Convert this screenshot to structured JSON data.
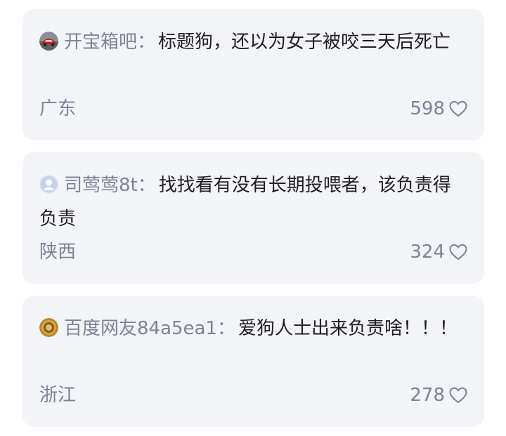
{
  "comments": [
    {
      "avatar_icon": "car-avatar-icon",
      "username": "开宝箱吧",
      "separator": "：",
      "text": "标题狗，还以为女子被咬三天后死亡",
      "location": "广东",
      "likes": "598"
    },
    {
      "avatar_icon": "default-user-avatar-icon",
      "username": "司莺莺8t",
      "separator": "：",
      "text": "找找看有没有长期投喂者，该负责得负责",
      "location": "陕西",
      "likes": "324"
    },
    {
      "avatar_icon": "coin-avatar-icon",
      "username": "百度网友84a5ea1",
      "separator": "：",
      "text": "爱狗人士出来负责啥！！！",
      "location": "浙江",
      "likes": "278"
    }
  ],
  "colors": {
    "card_bg": "#f3f4f8",
    "secondary_text": "#7b8494",
    "primary_text": "#1f1f1f"
  }
}
